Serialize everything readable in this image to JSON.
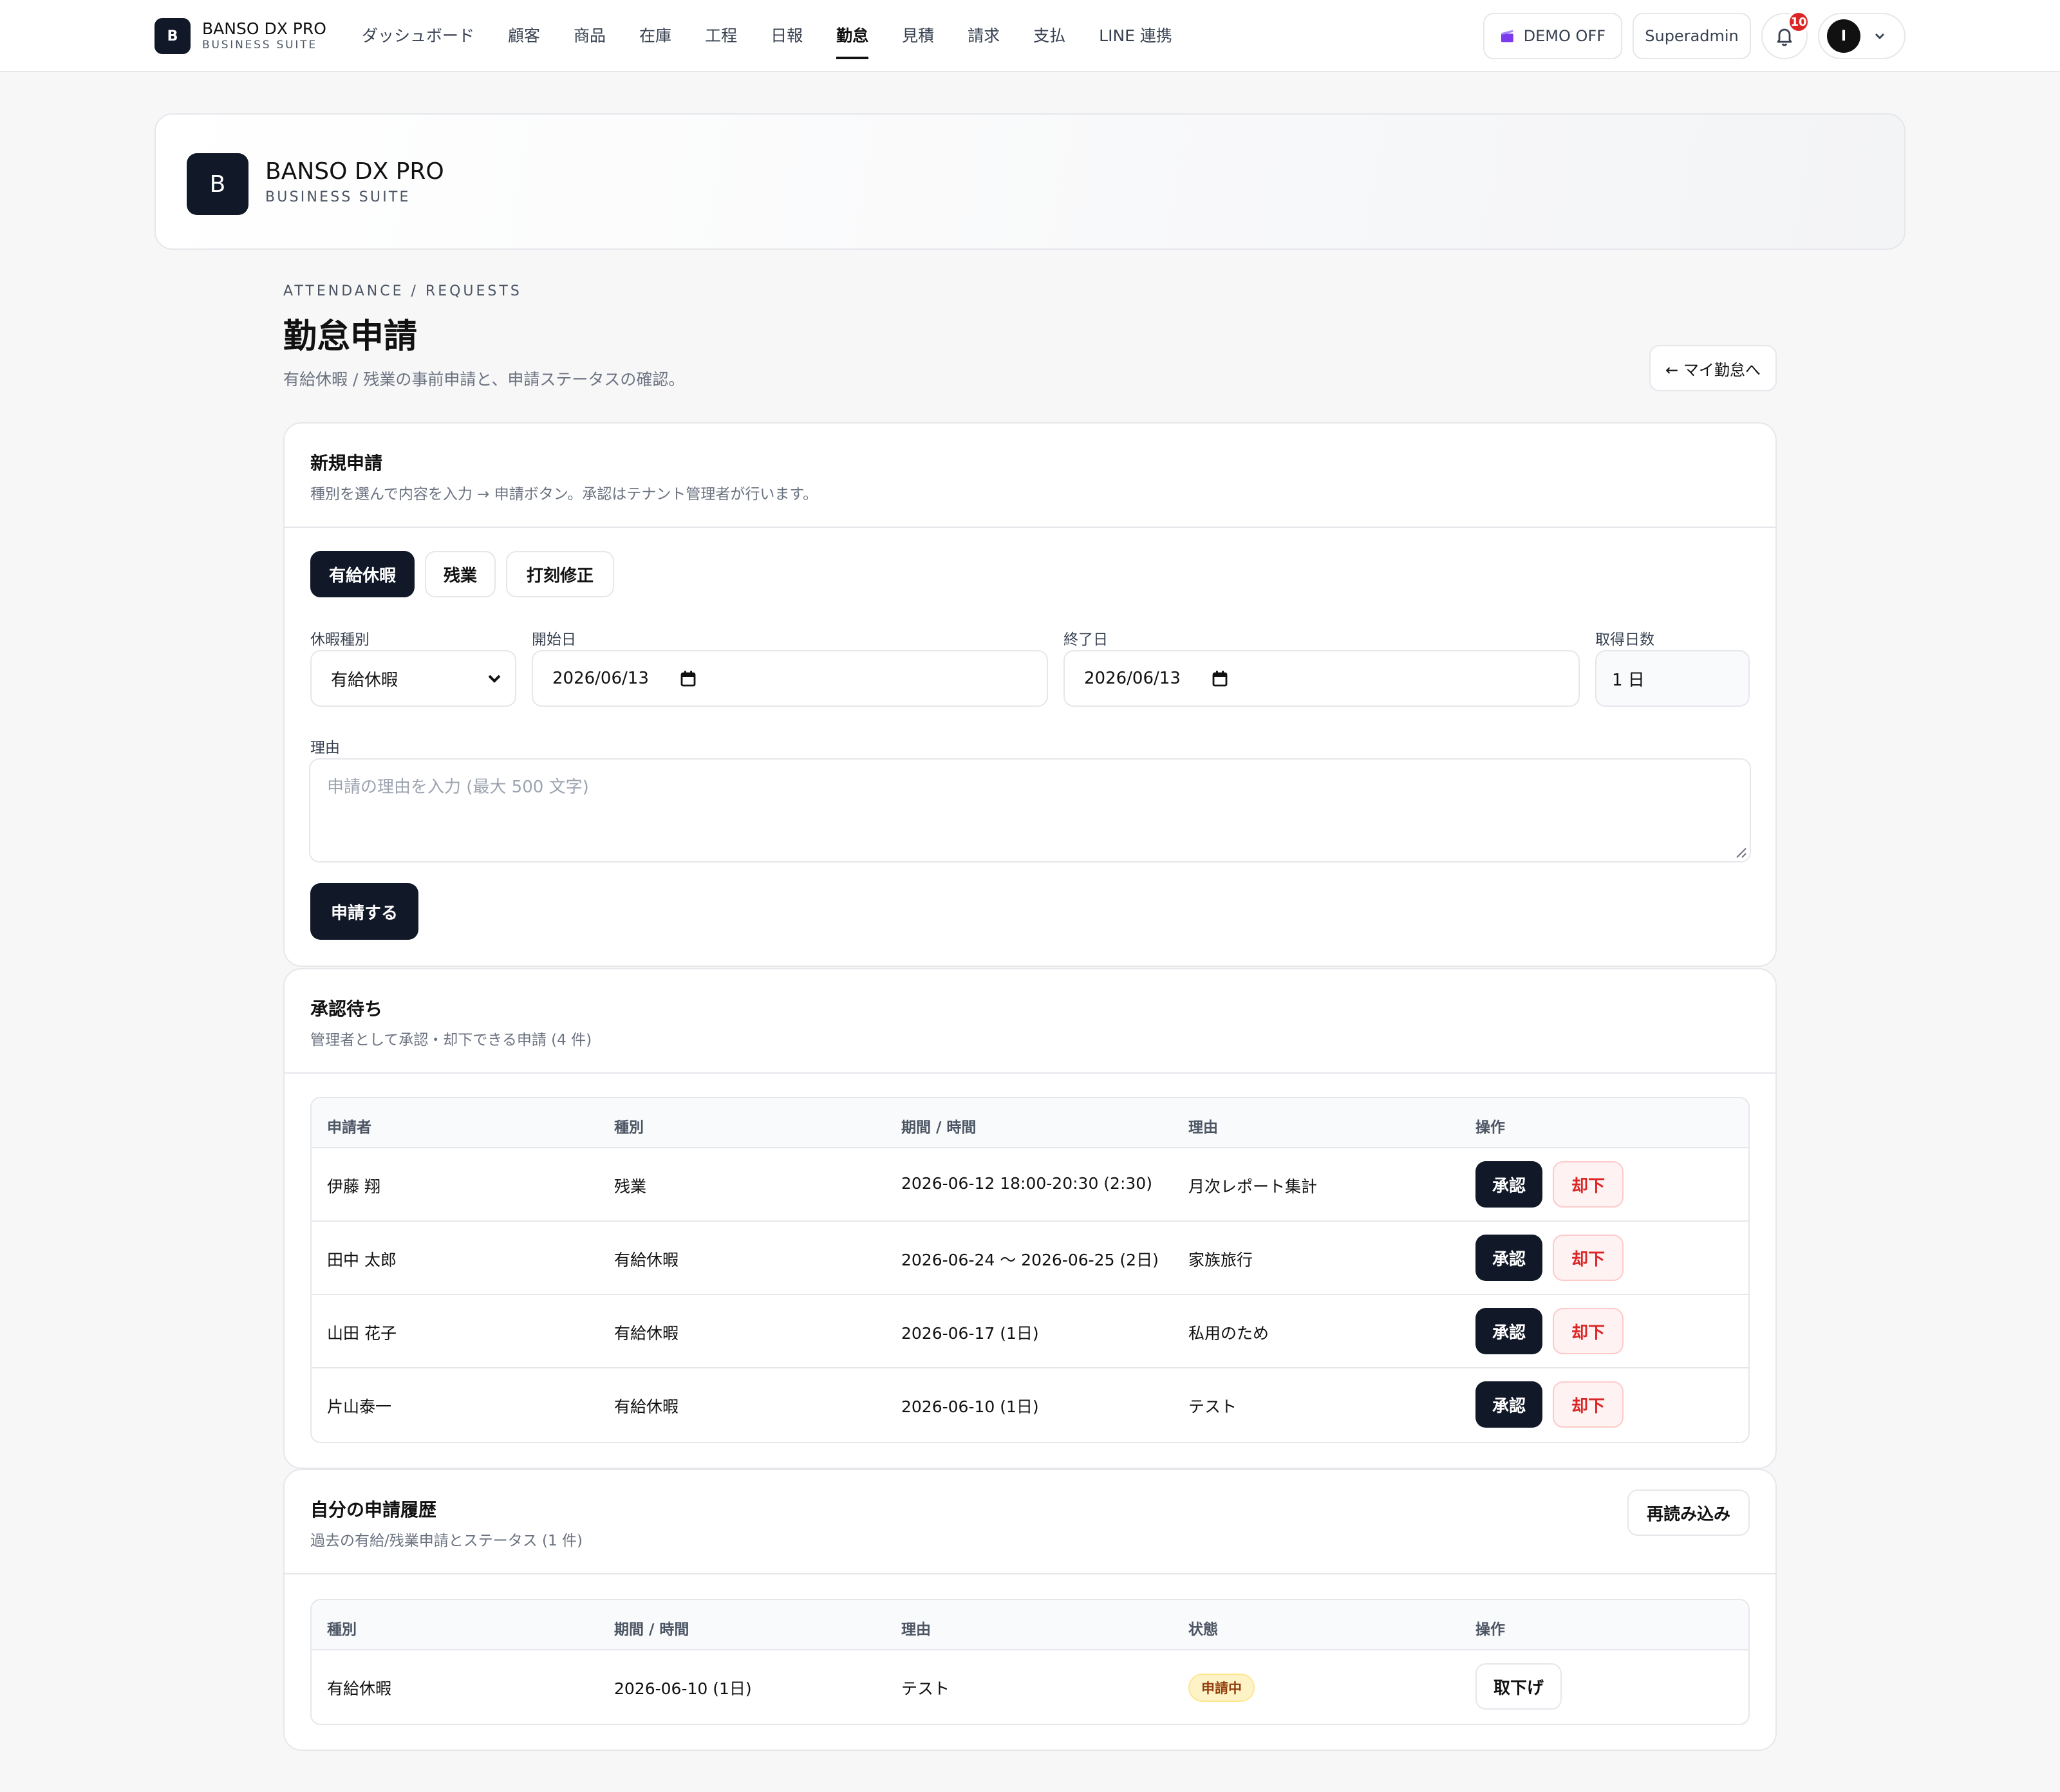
{
  "app": {
    "brand_name": "BANSO DX PRO",
    "brand_sub": "BUSINESS SUITE",
    "logo_letter": "B"
  },
  "nav": {
    "items": [
      {
        "label": "ダッシュボード",
        "active": false
      },
      {
        "label": "顧客",
        "active": false
      },
      {
        "label": "商品",
        "active": false
      },
      {
        "label": "在庫",
        "active": false
      },
      {
        "label": "工程",
        "active": false
      },
      {
        "label": "日報",
        "active": false
      },
      {
        "label": "勤怠",
        "active": true
      },
      {
        "label": "見積",
        "active": false
      },
      {
        "label": "請求",
        "active": false
      },
      {
        "label": "支払",
        "active": false
      },
      {
        "label": "LINE 連携",
        "active": false
      }
    ]
  },
  "topbar": {
    "demo_label": "DEMO OFF",
    "demo_icon": "clapperboard-icon",
    "role_label": "Superadmin",
    "notification_count": "10",
    "avatar_letter": "I"
  },
  "hero": {
    "logo_letter": "B",
    "name": "BANSO DX PRO",
    "sub": "BUSINESS SUITE"
  },
  "page": {
    "eyebrow": "ATTENDANCE / REQUESTS",
    "title": "勤怠申請",
    "description": "有給休暇 / 残業の事前申請と、申請ステータスの確認。",
    "back_label": "← マイ勤怠へ"
  },
  "new_request": {
    "title": "新規申請",
    "description": "種別を選んで内容を入力 → 申請ボタン。承認はテナント管理者が行います。",
    "tabs": [
      {
        "label": "有給休暇",
        "active": true
      },
      {
        "label": "残業",
        "active": false
      },
      {
        "label": "打刻修正",
        "active": false
      }
    ],
    "leave_type_label": "休暇種別",
    "leave_type_value": "有給休暇",
    "start_label": "開始日",
    "start_value": "2026/06/13",
    "end_label": "終了日",
    "end_value": "2026/06/13",
    "days_label": "取得日数",
    "days_value": "1 日",
    "reason_label": "理由",
    "reason_placeholder": "申請の理由を入力 (最大 500 文字)",
    "submit_label": "申請する"
  },
  "pending": {
    "title": "承認待ち",
    "description": "管理者として承認・却下できる申請 (4 件)",
    "columns": [
      "申請者",
      "種別",
      "期間 / 時間",
      "理由",
      "操作"
    ],
    "approve_label": "承認",
    "reject_label": "却下",
    "rows": [
      {
        "applicant": "伊藤 翔",
        "type": "残業",
        "period": "2026-06-12 18:00-20:30 (2:30)",
        "reason": "月次レポート集計"
      },
      {
        "applicant": "田中 太郎",
        "type": "有給休暇",
        "period": "2026-06-24 〜 2026-06-25 (2日)",
        "reason": "家族旅行"
      },
      {
        "applicant": "山田 花子",
        "type": "有給休暇",
        "period": "2026-06-17 (1日)",
        "reason": "私用のため"
      },
      {
        "applicant": "片山泰一",
        "type": "有給休暇",
        "period": "2026-06-10 (1日)",
        "reason": "テスト"
      }
    ]
  },
  "history": {
    "title": "自分の申請履歴",
    "description": "過去の有給/残業申請とステータス (1 件)",
    "reload_label": "再読み込み",
    "columns": [
      "種別",
      "期間 / 時間",
      "理由",
      "状態",
      "操作"
    ],
    "withdraw_label": "取下げ",
    "rows": [
      {
        "type": "有給休暇",
        "period": "2026-06-10 (1日)",
        "reason": "テスト",
        "status": "申請中"
      }
    ]
  },
  "colors": {
    "primary": "#111827",
    "danger": "#dc2626",
    "pending_badge_bg": "#fef3c7",
    "pending_badge_text": "#92400e"
  }
}
